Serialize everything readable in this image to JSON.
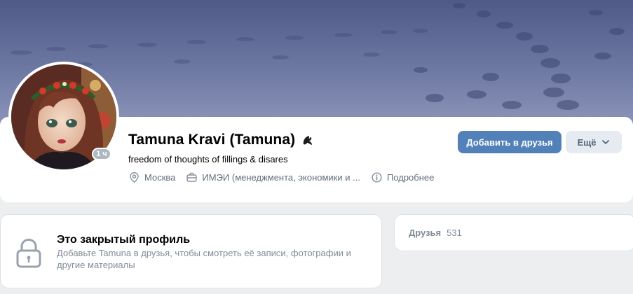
{
  "profile": {
    "name": "Tamuna Kravi (Tamuna)",
    "status": "freedom of thoughts of fillings & disares",
    "online_badge": "1 ч",
    "city": "Москва",
    "education": "ИМЭИ (менеджмента, экономики и ...",
    "details_label": "Подробнее"
  },
  "actions": {
    "add_friend_label": "Добавить в друзья",
    "more_label": "Ещё"
  },
  "closed_profile": {
    "title": "Это закрытый профиль",
    "description": "Добавьте Tamuna в друзья, чтобы смотреть её записи, фотографии и другие материалы"
  },
  "friends": {
    "label": "Друзья",
    "count": "531"
  },
  "colors": {
    "accent": "#5181b8",
    "secondary_button": "#e5ebf1",
    "page_background": "#edeef0",
    "muted_text": "#818c99"
  },
  "icons": {
    "verified": "dragon-emoji-icon",
    "city": "location-pin-icon",
    "education": "briefcase-icon",
    "details": "info-circle-icon",
    "more": "chevron-down-icon",
    "closed": "lock-icon"
  }
}
